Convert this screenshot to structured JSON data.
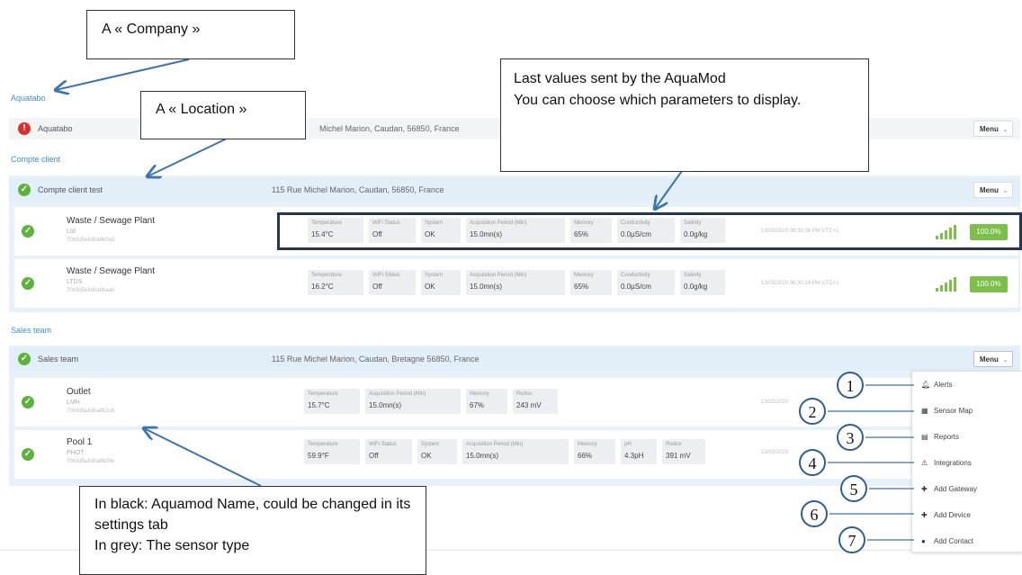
{
  "company": {
    "link": "Aquatabo",
    "name": "Aquatabo",
    "address": "Michel Marion, Caudan, 56850, France",
    "menu": "Menu"
  },
  "locations": [
    {
      "link": "Compte client",
      "name": "Compte client test",
      "address": "115 Rue Michel Marion, Caudan, 56850, France",
      "menu": "Menu",
      "devices": [
        {
          "name": "Waste / Sewage Plant",
          "type": "Ltd",
          "id": "70b3d5e8d0a8b0a3",
          "timestamp": "13/03/2020 08:30:38 PM UTC+1",
          "battery": "100.0%",
          "params": [
            {
              "label": "Temperature",
              "value": "15.4°C"
            },
            {
              "label": "WiFi Status",
              "value": "Off"
            },
            {
              "label": "System",
              "value": "OK"
            },
            {
              "label": "Acquisition Period (Min)",
              "value": "15.0mn(s)"
            },
            {
              "label": "Memory",
              "value": "65%"
            },
            {
              "label": "Conductivity",
              "value": "0.0µS/cm"
            },
            {
              "label": "Salinity",
              "value": "0.0g/kg"
            }
          ]
        },
        {
          "name": "Waste / Sewage Plant",
          "type": "LTDS",
          "id": "70b3d5e8d0a8baa0",
          "timestamp": "13/03/2020 08:30:24 PM UTC+1",
          "battery": "100.0%",
          "params": [
            {
              "label": "Temperature",
              "value": "16.2°C"
            },
            {
              "label": "WiFi Status",
              "value": "Off"
            },
            {
              "label": "System",
              "value": "OK"
            },
            {
              "label": "Acquisition Period (Min)",
              "value": "15.0mn(s)"
            },
            {
              "label": "Memory",
              "value": "65%"
            },
            {
              "label": "Conductivity",
              "value": "0.0µS/cm"
            },
            {
              "label": "Salinity",
              "value": "0.0g/kg"
            }
          ]
        }
      ]
    },
    {
      "link": "Sales team",
      "name": "Sales team",
      "address": "115 Rue Michel Marion, Caudan, Bretagne 56850, France",
      "menu": "Menu",
      "devices": [
        {
          "name": "Outlet",
          "type": "LMH",
          "id": "70b3d5e8d0a8b2c6",
          "timestamp": "13/03/2020",
          "params": [
            {
              "label": "Temperature",
              "value": "15.7°C"
            },
            {
              "label": "Acquisition Period (Min)",
              "value": "15.0mn(s)"
            },
            {
              "label": "Memory",
              "value": "67%"
            },
            {
              "label": "Redox",
              "value": "243 mV"
            }
          ]
        },
        {
          "name": "Pool 1",
          "type": "PHOT",
          "id": "70b3d5e8d0a8b09e",
          "timestamp": "13/03/2020",
          "params": [
            {
              "label": "Temperature",
              "value": "59.9°F"
            },
            {
              "label": "WiFi Status",
              "value": "Off"
            },
            {
              "label": "System",
              "value": "OK"
            },
            {
              "label": "Acquisition Period (Min)",
              "value": "15.0mn(s)"
            },
            {
              "label": "Memory",
              "value": "66%"
            },
            {
              "label": "pH",
              "value": "4.3pH"
            },
            {
              "label": "Redox",
              "value": "391 mV"
            }
          ]
        }
      ]
    }
  ],
  "dropdown": {
    "items": [
      {
        "label": "Alerts",
        "icon": "bell-icon",
        "number": "1"
      },
      {
        "label": "Sensor Map",
        "icon": "map-icon",
        "number": "2"
      },
      {
        "label": "Reports",
        "icon": "report-icon",
        "number": "3"
      },
      {
        "label": "Integrations",
        "icon": "integration-icon",
        "number": "4"
      },
      {
        "label": "Add Gateway",
        "icon": "plus-icon",
        "number": "5"
      },
      {
        "label": "Add Device",
        "icon": "plus-icon",
        "number": "6"
      },
      {
        "label": "Add Contact",
        "icon": "contact-icon",
        "number": "7"
      }
    ]
  },
  "callouts": {
    "company": "A « Company »",
    "location": "A « Location »",
    "last_values": "Last values sent by the AquaMod\nYou can choose which parameters to display.",
    "name_type": "In black: Aquamod Name, could be changed in its settings tab\nIn grey: The sensor type"
  },
  "colors": {
    "ok": "#5bb33b",
    "error": "#d9302b",
    "link": "#3c8fd6",
    "battery": "#7cc04a",
    "highlight": "#233654"
  }
}
